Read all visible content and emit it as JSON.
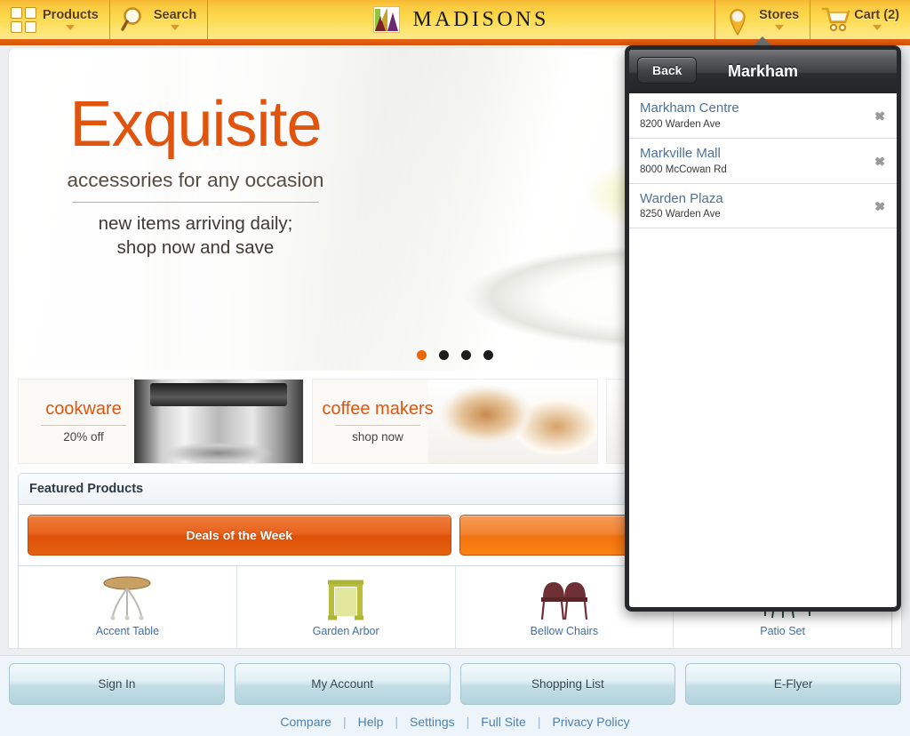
{
  "topnav": {
    "products": {
      "label": "Products",
      "icon": "grid-icon"
    },
    "search": {
      "label": "Search",
      "icon": "search-icon"
    },
    "brand": "MADISONS",
    "stores": {
      "label": "Stores",
      "icon": "map-pin-icon"
    },
    "cart": {
      "label": "Cart (2)",
      "icon": "shopping-cart-icon"
    },
    "accent": "#f7b733",
    "rule_color": "#e8620f"
  },
  "hero": {
    "title": "Exquisite",
    "subtitle": "accessories for any occasion",
    "line1": "new items arriving daily;",
    "line2": "shop now and save",
    "title_color": "#e1540e",
    "dots": 4,
    "active_dot": 0
  },
  "promos": [
    {
      "heading": "cookware",
      "sub": "20% off",
      "image": "stainless-pot-photo"
    },
    {
      "heading": "coffee makers",
      "sub": "shop now",
      "image": "latte-cups-photo"
    }
  ],
  "featured": {
    "title": "Featured Products",
    "tabs": [
      {
        "label": "Deals of the Week",
        "state": "active"
      },
      {
        "label": "",
        "state": "inactive"
      }
    ],
    "products": [
      {
        "name": "Accent Table",
        "image": "accent-table-thumb"
      },
      {
        "name": "Garden Arbor",
        "image": "garden-arbor-thumb"
      },
      {
        "name": "Bellow Chairs",
        "image": "bellow-chairs-thumb"
      },
      {
        "name": "Patio Set",
        "image": "patio-set-thumb"
      }
    ]
  },
  "footer": {
    "buttons": [
      {
        "label": "Sign In"
      },
      {
        "label": "My Account"
      },
      {
        "label": "Shopping List"
      },
      {
        "label": "E-Flyer"
      }
    ],
    "links": [
      "Compare",
      "Help",
      "Settings",
      "Full Site",
      "Privacy Policy"
    ],
    "separator": "|"
  },
  "stores_panel": {
    "back_label": "Back",
    "title": "Markham",
    "items": [
      {
        "name": "Markham Centre",
        "address": "8200 Warden Ave"
      },
      {
        "name": "Markville Mall",
        "address": "8000 McCowan Rd"
      },
      {
        "name": "Warden Plaza",
        "address": "8250 Warden Ave"
      }
    ]
  }
}
